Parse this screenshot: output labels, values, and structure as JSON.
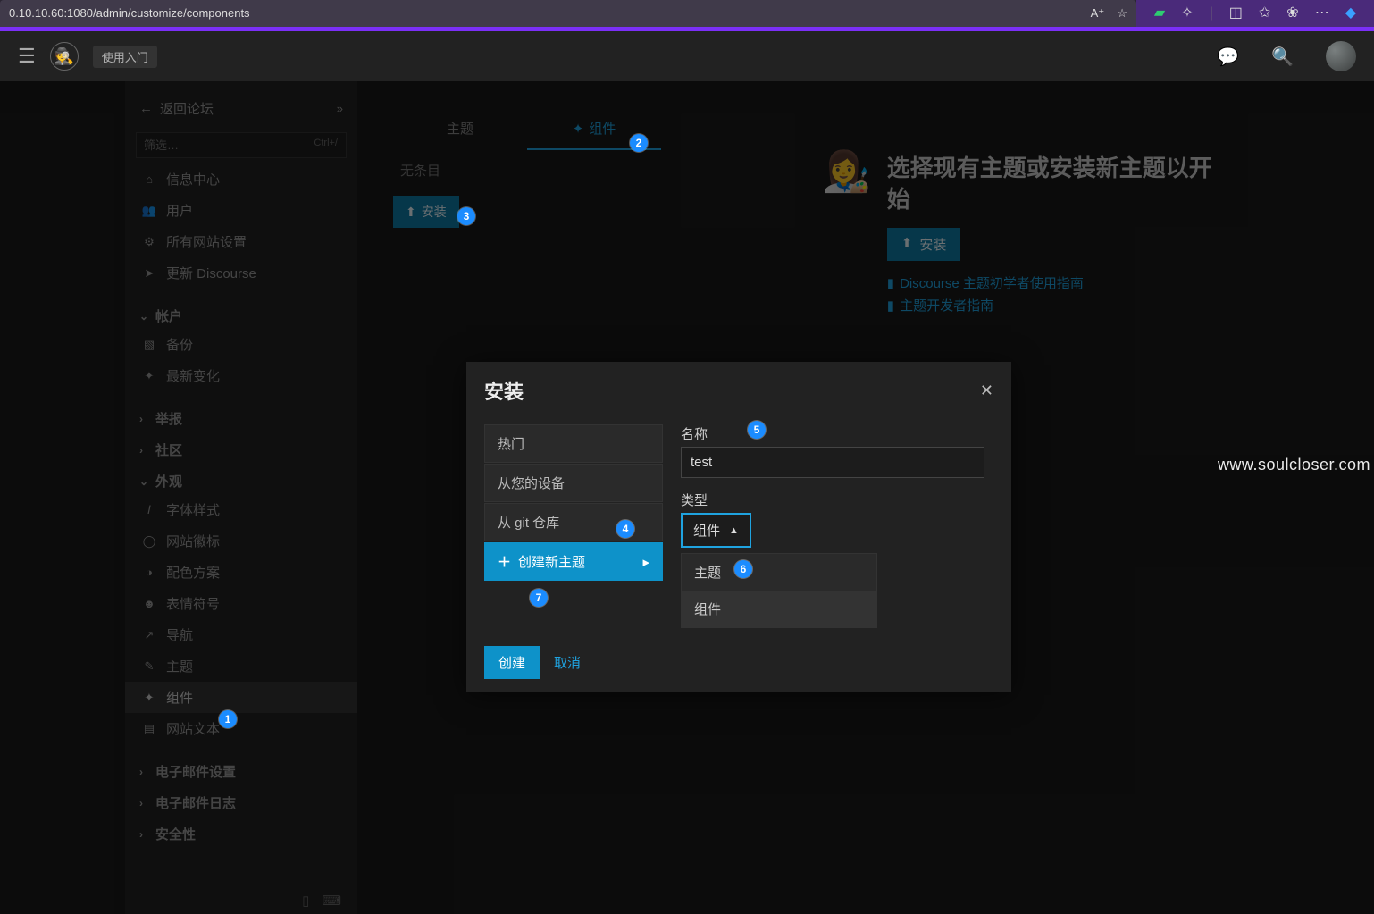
{
  "browser": {
    "url": "0.10.10.60:1080/admin/customize/components"
  },
  "header": {
    "quickstart": "使用入门"
  },
  "sidebar": {
    "back_label": "返回论坛",
    "filter_placeholder": "筛选…",
    "filter_hint": "Ctrl+/",
    "items_top": [
      {
        "label": "信息中心"
      },
      {
        "label": "用户"
      },
      {
        "label": "所有网站设置"
      },
      {
        "label": "更新 Discourse"
      }
    ],
    "section_account": "帐户",
    "items_account": [
      {
        "label": "备份"
      },
      {
        "label": "最新变化"
      }
    ],
    "section_report": "举报",
    "section_community": "社区",
    "section_appearance": "外观",
    "items_appearance": [
      {
        "label": "字体样式"
      },
      {
        "label": "网站徽标"
      },
      {
        "label": "配色方案"
      },
      {
        "label": "表情符号"
      },
      {
        "label": "导航"
      },
      {
        "label": "主题"
      },
      {
        "label": "组件"
      },
      {
        "label": "网站文本"
      }
    ],
    "section_emailset": "电子邮件设置",
    "section_emaillog": "电子邮件日志",
    "section_security": "安全性"
  },
  "tabs": {
    "themes": "主题",
    "components": "组件"
  },
  "content": {
    "empty": "无条目",
    "install_btn": "安装"
  },
  "hero": {
    "title": "选择现有主题或安装新主题以开始",
    "install_btn": "安装",
    "link1": "Discourse 主题初学者使用指南",
    "link2": "主题开发者指南"
  },
  "modal": {
    "title": "安装",
    "left": {
      "popular": "热门",
      "from_device": "从您的设备",
      "from_git": "从 git 仓库",
      "create_new": "创建新主题"
    },
    "name_label": "名称",
    "name_value": "test",
    "type_label": "类型",
    "type_selected": "组件",
    "options": {
      "theme": "主题",
      "component": "组件"
    },
    "create_btn": "创建",
    "cancel_btn": "取消"
  },
  "badges": {
    "b1": "1",
    "b2": "2",
    "b3": "3",
    "b4": "4",
    "b5": "5",
    "b6": "6",
    "b7": "7"
  },
  "watermark": "www.soulcloser.com"
}
